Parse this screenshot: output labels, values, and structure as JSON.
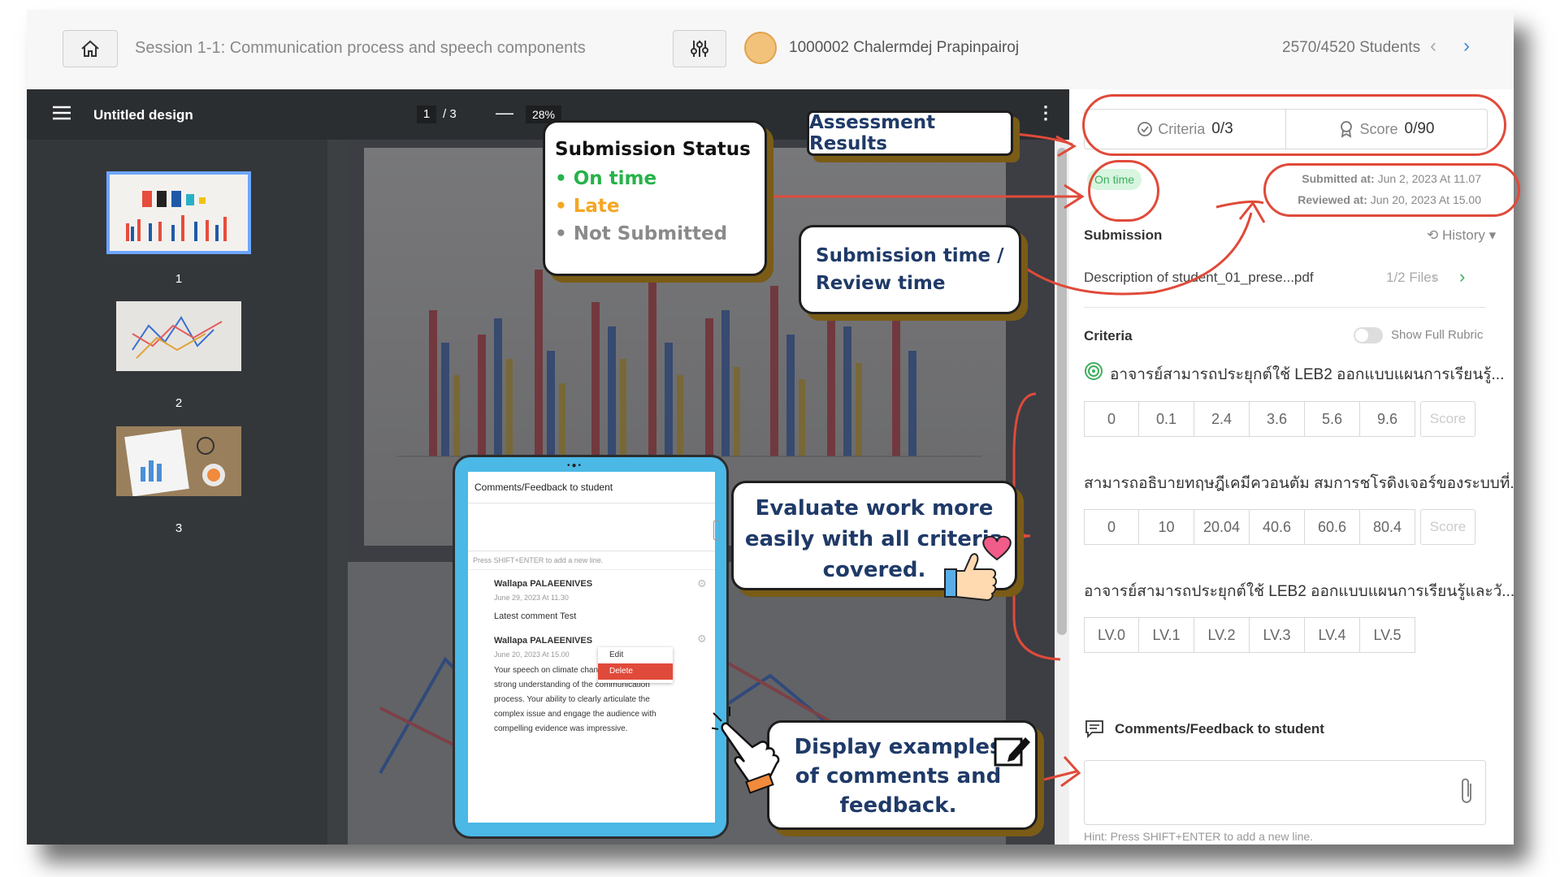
{
  "topbar": {
    "session_title": "Session 1-1: Communication process and speech components",
    "student_name": "1000002 Chalermdej Prapinpairoj",
    "student_count": "2570/4520 Students",
    "prev": "‹",
    "next": "›"
  },
  "viewer": {
    "doc_title": "Untitled design",
    "current_page": "1",
    "total_pages": "/ 3",
    "zoom": "28%",
    "thumbnails": [
      "1",
      "2",
      "3"
    ]
  },
  "panel": {
    "criteria_label": "Criteria",
    "criteria_value": "0/3",
    "score_label": "Score",
    "score_value": "0/90",
    "status_badge": "On time",
    "submitted_label": "Submitted at:",
    "submitted_value": "Jun 2, 2023 At 11.07",
    "reviewed_label": "Reviewed at:",
    "reviewed_value": "Jun 20, 2023 At 15.00",
    "submission_heading": "Submission",
    "history_label": "History",
    "file_name": "Description of student_01_prese...pdf",
    "file_count": "1/2 Files",
    "criteria_heading": "Criteria",
    "show_full_rubric": "Show Full Rubric",
    "criteria": [
      {
        "title": "อาจารย์สามารถประยุกต์ใช้ LEB2 ออกแบบแผนการเรียนรู้...",
        "options": [
          "0",
          "0.1",
          "2.4",
          "3.6",
          "5.6",
          "9.6"
        ],
        "score_placeholder": "Score"
      },
      {
        "title": "สามารถอธิบายทฤษฎีเคมีควอนตัม สมการชโรดิงเจอร์ของระบบที่...",
        "options": [
          "0",
          "10",
          "20.04",
          "40.6",
          "60.6",
          "80.4"
        ],
        "score_placeholder": "Score"
      },
      {
        "title": "อาจารย์สามารถประยุกต์ใช้ LEB2 ออกแบบแผนการเรียนรู้และวั...",
        "options": [
          "LV.0",
          "LV.1",
          "LV.2",
          "LV.3",
          "LV.4",
          "LV.5"
        ]
      }
    ],
    "comments_heading": "Comments/Feedback to student",
    "hint": "Hint: Press SHIFT+ENTER to add a new line."
  },
  "callouts": {
    "submission_status": {
      "title": "Submission Status",
      "items": [
        "On time",
        "Late",
        "Not Submitted"
      ],
      "colors": [
        "#27b24a",
        "#f5a623",
        "#8a8a8a"
      ]
    },
    "assessment_results": "Assessment Results",
    "submission_time": "Submission time / Review time",
    "evaluate": "Evaluate work more easily with all criteria covered.",
    "examples": "Display examples of comments and feedback."
  },
  "tablet": {
    "heading": "Comments/Feedback to student",
    "hint": "Press SHIFT+ENTER to add a new line.",
    "comments": [
      {
        "author": "Wallapa PALAEENIVES",
        "date": "June 29, 2023 At 11.30",
        "text": "Latest comment Test"
      },
      {
        "author": "Wallapa PALAEENIVES",
        "date": "June 20, 2023 At 15.00",
        "text": "Your speech on climate change demonstrated a strong understanding of the communication process. Your ability to clearly articulate the complex issue and engage the audience with compelling evidence was impressive."
      }
    ],
    "menu": [
      "Edit",
      "Delete"
    ]
  },
  "colors": {
    "accent_red": "#e04a3a",
    "callout_text": "#1f3a68",
    "on_time_green": "#3fae5f"
  }
}
